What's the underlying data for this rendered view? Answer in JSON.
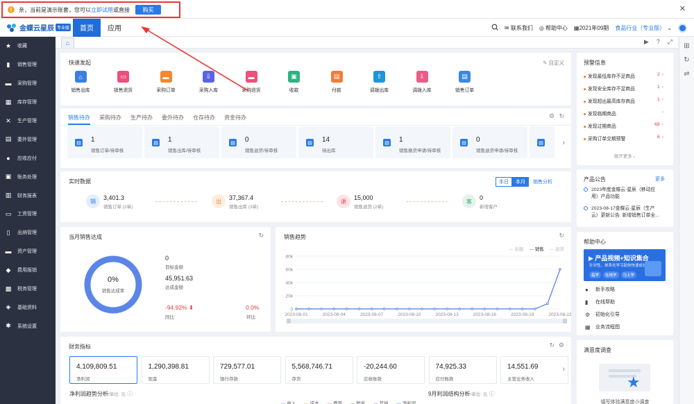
{
  "notice": {
    "warn_glyph": "!",
    "text_before": "亲，当前是演示账套，您可以",
    "try_link": "立即试用",
    "text_or": "或直接",
    "buy_label": "购买",
    "close_glyph": "✕"
  },
  "topbar": {
    "brand": "金蝶云星辰",
    "edition": "专业版",
    "tabs": [
      {
        "label": "首页"
      },
      {
        "label": "应用"
      }
    ],
    "contact": "联系我们",
    "help": "帮助中心",
    "period": "2021年09期",
    "industry": "食品行业（专业版）"
  },
  "sidebar": {
    "items": [
      {
        "label": "收藏",
        "icon": "★"
      },
      {
        "label": "销售管理",
        "icon": "▮"
      },
      {
        "label": "采购管理",
        "icon": "▬"
      },
      {
        "label": "库存管理",
        "icon": "▦"
      },
      {
        "label": "生产管理",
        "icon": "✕"
      },
      {
        "label": "委外管理",
        "icon": "▤"
      },
      {
        "label": "应收应付",
        "icon": "●"
      },
      {
        "label": "账务处理",
        "icon": "▣"
      },
      {
        "label": "财务报表",
        "icon": "▥"
      },
      {
        "label": "工资管理",
        "icon": "▭"
      },
      {
        "label": "出纳管理",
        "icon": "▯"
      },
      {
        "label": "资产管理",
        "icon": "▬"
      },
      {
        "label": "费用报销",
        "icon": "◆"
      },
      {
        "label": "税务管理",
        "icon": "▩"
      },
      {
        "label": "基础资料",
        "icon": "◈"
      },
      {
        "label": "系统设置",
        "icon": "✱"
      }
    ]
  },
  "quick": {
    "title": "快速发起",
    "customize": "自定义",
    "items": [
      {
        "label": "销售出库",
        "color": "#3c7fe0",
        "icon": "⌂"
      },
      {
        "label": "销售退货",
        "color": "#ee4f7c",
        "icon": "▭"
      },
      {
        "label": "采购订单",
        "color": "#f5882c",
        "icon": "▬"
      },
      {
        "label": "采购入库",
        "color": "#5a64e2",
        "icon": "⇩"
      },
      {
        "label": "采购退货",
        "color": "#ee4f7c",
        "icon": "▬"
      },
      {
        "label": "收款",
        "color": "#2bb380",
        "icon": "▣"
      },
      {
        "label": "付款",
        "color": "#ef7c3a",
        "icon": "▤"
      },
      {
        "label": "调拨出库",
        "color": "#1f95d9",
        "icon": "⇧"
      },
      {
        "label": "调拨入库",
        "color": "#ee5a87",
        "icon": "⇩"
      },
      {
        "label": "销售订单",
        "color": "#3c88e3",
        "icon": "▤"
      }
    ]
  },
  "todo": {
    "tabs": [
      "销售待办",
      "采购待办",
      "生产待办",
      "委外待办",
      "仓存待办",
      "资金待办"
    ],
    "cards": [
      {
        "value": "1",
        "label": "销售订单/待审核"
      },
      {
        "value": "1",
        "label": "销售出库/待审核"
      },
      {
        "value": "0",
        "label": "销售退货/待审核"
      },
      {
        "value": "14",
        "label": "待出库"
      },
      {
        "value": "1",
        "label": "销售换货申请/待审核"
      },
      {
        "value": "0",
        "label": "销售退货申请/待审核"
      }
    ]
  },
  "realtime": {
    "title": "实时数据",
    "today": "本日",
    "month": "本月",
    "analysis": "销售分析",
    "items": [
      {
        "badge": "销",
        "value": "3,401.3",
        "label": "销售订单 (2单)",
        "bg": "#e3eefc",
        "fg": "#2a7be4"
      },
      {
        "badge": "出",
        "value": "37,367.4",
        "label": "销售出库 (3单)",
        "bg": "#fdeedd",
        "fg": "#e8892e"
      },
      {
        "badge": "退",
        "value": "15,000",
        "label": "销售退货 (2单)",
        "bg": "#fde4e6",
        "fg": "#e53950"
      },
      {
        "badge": "客",
        "value": "0",
        "label": "新增客户",
        "bg": "#e6f2ec",
        "fg": "#3aa56c"
      }
    ]
  },
  "month_sales": {
    "title": "当月销售达成",
    "donut_value": "0%",
    "donut_label": "销售达成率",
    "target_value": "0",
    "target_label": "目标金额",
    "actual_value": "45,951.63",
    "actual_label": "达成金额",
    "yoy_value": "-94.92% ⬇",
    "yoy_label": "同比",
    "mom_value": "0.0%",
    "mom_label": "环比"
  },
  "trend": {
    "title": "销售趋势",
    "legend": [
      "余额",
      "销售",
      "退货"
    ]
  },
  "chart_data": {
    "type": "line",
    "x": [
      "2023-08-01",
      "2023-08-02",
      "2023-08-03",
      "2023-08-04",
      "2023-08-05",
      "2023-08-06",
      "2023-08-07",
      "2023-08-08",
      "2023-08-09",
      "2023-08-10",
      "2023-08-11",
      "2023-08-12",
      "2023-08-13",
      "2023-08-14",
      "2023-08-15",
      "2023-08-16",
      "2023-08-17",
      "2023-08-18",
      "2023-08-19",
      "2023-08-20",
      "2023-08-21",
      "2023-08-22"
    ],
    "tick_labels": [
      "2023-08-01",
      "2023-08-04",
      "2023-08-07",
      "2023-08-10",
      "2023-08-13",
      "2023-08-16",
      "2023-08-19",
      "2023-08-22"
    ],
    "series": [
      {
        "name": "销售",
        "values": [
          0,
          0,
          0,
          0,
          0,
          0,
          0,
          0,
          0,
          0,
          0,
          0,
          0,
          0,
          0,
          0,
          0,
          0,
          0,
          0,
          8000,
          60000
        ]
      }
    ],
    "ylim": [
      0,
      80000
    ],
    "yticks": [
      0,
      20000,
      40000,
      60000,
      80000
    ],
    "ytick_labels": [
      "0",
      "20k",
      "40k",
      "60k",
      "80k"
    ],
    "grid": true,
    "legend": "top-right"
  },
  "finance": {
    "title": "财务指标",
    "cards": [
      {
        "value": "4,109,809.51",
        "label": "净利润"
      },
      {
        "value": "1,290,398.81",
        "label": "现金"
      },
      {
        "value": "729,577.01",
        "label": "银行存款"
      },
      {
        "value": "5,568,746.71",
        "label": "存货"
      },
      {
        "value": "-20,244.60",
        "label": "应收账款"
      },
      {
        "value": "74,925.33",
        "label": "应付账款"
      },
      {
        "value": "14,551.69",
        "label": "主营业务收入"
      }
    ],
    "profit_trend": "净利润趋势分析",
    "profit_structure": "9月利润结构分析",
    "unit": "/单位: 元",
    "bottom_legend": [
      "收入",
      "成本",
      "费用",
      "税金",
      "其他",
      "净利润"
    ]
  },
  "warnings": {
    "title": "预警信息",
    "items": [
      {
        "label": "发现最低库存不足商品",
        "count": "2"
      },
      {
        "label": "发现安全库存不足商品",
        "count": "1"
      },
      {
        "label": "发现超出最高库存商品",
        "count": "1"
      },
      {
        "label": "发现临期商品",
        "count": ""
      },
      {
        "label": "发现过期商品",
        "count": "68"
      },
      {
        "label": "采购订单交期预警",
        "count": "6"
      }
    ],
    "more": "展开更多"
  },
  "announcements": {
    "title": "产品公告",
    "more": "更多",
    "items": [
      {
        "line1": "2023年度金蝶云·星辰（移动应",
        "line2": "用）产品功能"
      },
      {
        "line1": "2023-08-17金蝶云·星辰（生产",
        "line2": "云）更新公告: 新增销售订单全..."
      }
    ]
  },
  "help_center": {
    "title": "帮助中心",
    "banner_title": "产品视频+知识集合",
    "banner_sub": "针对性、体系化学习助你快速成长！",
    "banner_tags": [
      "指学",
      "在线学",
      "马上学"
    ],
    "items": [
      {
        "label": "新手攻略",
        "icon": "●"
      },
      {
        "label": "在线帮助",
        "icon": "▮"
      },
      {
        "label": "初始化引导",
        "icon": "⚙"
      },
      {
        "label": "业务流程图",
        "icon": "▦"
      }
    ]
  },
  "survey": {
    "title": "满意度调查",
    "text": "填写体验满意度小调查"
  }
}
